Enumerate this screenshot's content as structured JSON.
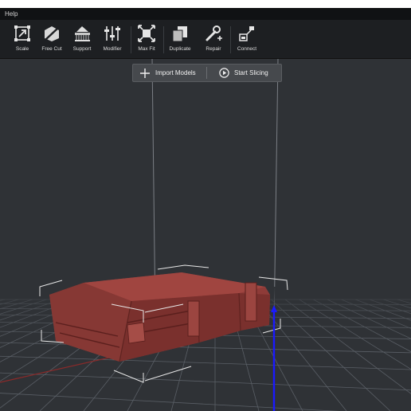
{
  "menubar": {
    "items": [
      "Help"
    ]
  },
  "toolbar": {
    "tools": [
      {
        "id": "scale",
        "label": "Scale",
        "icon": "scale-icon"
      },
      {
        "id": "free-cut",
        "label": "Free Cut",
        "icon": "free-cut-icon"
      },
      {
        "id": "support",
        "label": "Support",
        "icon": "support-icon"
      },
      {
        "id": "modifier",
        "label": "Modifier",
        "icon": "modifier-icon"
      },
      {
        "id": "max-fit",
        "label": "Max Fit",
        "icon": "max-fit-icon"
      },
      {
        "id": "duplicate",
        "label": "Duplicate",
        "icon": "duplicate-icon"
      },
      {
        "id": "repair",
        "label": "Repair",
        "icon": "repair-icon"
      },
      {
        "id": "connect",
        "label": "Connect",
        "icon": "connect-icon"
      }
    ]
  },
  "floating_actions": {
    "import_label": "Import Models",
    "import_icon": "plus-icon",
    "slice_label": "Start Slicing",
    "slice_icon": "play-circle-icon"
  },
  "colors": {
    "viewport_bg": "#2f3236",
    "model": "#8e3b38",
    "grid": "#5a5f66",
    "z_axis": "#1a1aff",
    "x_axis": "#8a2a2a"
  }
}
